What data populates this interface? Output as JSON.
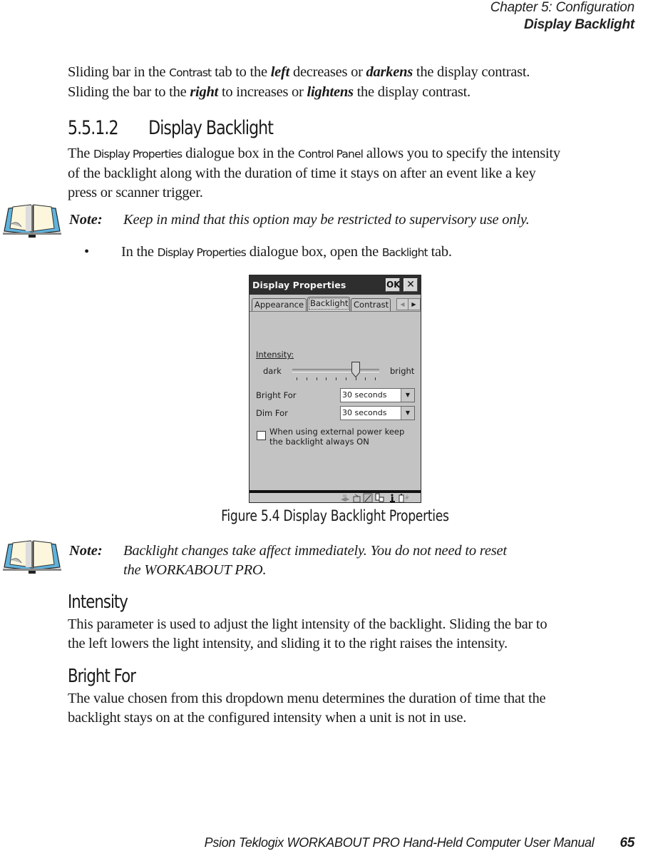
{
  "running_header": {
    "chapter": "Chapter  5:  Configuration",
    "section": "Display Backlight"
  },
  "intro": {
    "line1": {
      "a": "Sliding bar in the ",
      "tab_name": "Contrast",
      "b": " tab to the ",
      "left": "left",
      "c": " decreases or ",
      "darkens": "darkens",
      "d": " the display contrast."
    },
    "line2": {
      "a": "Sliding the bar to the ",
      "right": "right",
      "b": " to increases or ",
      "lightens": "lightens",
      "c": " the display contrast."
    }
  },
  "section": {
    "number": "5.5.1.2",
    "title": "Display Backlight",
    "para": {
      "a": "The ",
      "dlg_name": "Display Properties",
      "b": " dialogue box in the ",
      "panel_name": "Control Panel",
      "c": " allows you to specify the intensity",
      "line2": "of the backlight along with the duration of time it stays on after an event like a key",
      "line3": "press or scanner trigger."
    }
  },
  "note1": {
    "label": "Note:",
    "text": "Keep in mind that this option may be restricted to supervisory use only."
  },
  "bullet": {
    "symbol": "•",
    "a": "In the ",
    "dlg_name": "Display Properties",
    "b": " dialogue box, open the ",
    "tab_name": "Backlight",
    "c": " tab."
  },
  "dialog": {
    "title": "Display Properties",
    "ok_label": "OK",
    "close_label": "✕",
    "tabs": [
      {
        "label": "Appearance",
        "active": false
      },
      {
        "label": "Backlight",
        "active": true
      },
      {
        "label": "Contrast",
        "active": false
      }
    ],
    "tab_scroll_left": "◀",
    "tab_scroll_right": "▶",
    "intensity": {
      "label": "Intensity:",
      "min_label": "dark",
      "max_label": "bright",
      "tick_count": 9,
      "position_index": 6,
      "position_fraction": 0.75
    },
    "bright_for": {
      "label": "Bright For",
      "value": "30 seconds"
    },
    "dim_for": {
      "label": "Dim For",
      "value": "30 seconds"
    },
    "combo_arrow": "▼",
    "external_power": {
      "label_line1": "When using external power keep",
      "label_line2": "the backlight always ON",
      "checked": false
    },
    "tray_icons": [
      "network-icon",
      "keyboard-icon",
      "signal-icon",
      "connection-icon",
      "info-icon",
      "battery-charging-icon"
    ]
  },
  "figure": {
    "caption": "Figure  5.4  Display  Backlight  Properties"
  },
  "note2": {
    "label": "Note:",
    "line1": "Backlight changes take affect immediately. You do not need to reset",
    "line2": "the WORKABOUT PRO."
  },
  "intensity_section": {
    "title": "Intensity",
    "line1": "This parameter is used to adjust the light intensity of the backlight. Sliding the bar to",
    "line2": "the left lowers the light intensity, and sliding it to the right raises the intensity."
  },
  "bright_for_section": {
    "title": "Bright  For",
    "line1": "The value chosen from this dropdown menu determines the duration of time that the",
    "line2": "backlight stays on at the configured intensity when a unit is not in use."
  },
  "footer": {
    "manual_title": "Psion Teklogix WORKABOUT PRO Hand-Held Computer User Manual",
    "page_number": "65"
  }
}
